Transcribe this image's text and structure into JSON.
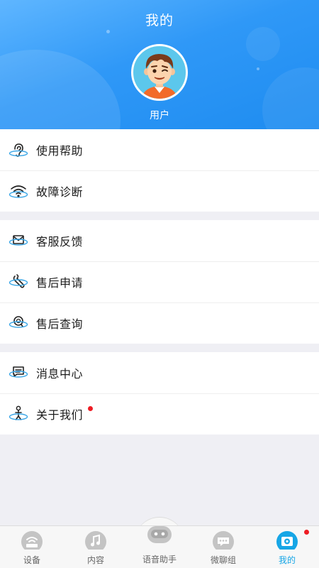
{
  "header": {
    "title": "我的",
    "username": "用户"
  },
  "menu_groups": [
    {
      "items": [
        {
          "label": "使用帮助",
          "icon": "help-ear-icon"
        },
        {
          "label": "故障诊断",
          "icon": "wifi-diagnose-icon"
        }
      ]
    },
    {
      "items": [
        {
          "label": "客服反馈",
          "icon": "mail-feedback-icon"
        },
        {
          "label": "售后申请",
          "icon": "wrench-service-icon"
        },
        {
          "label": "售后查询",
          "icon": "search-query-icon"
        }
      ]
    },
    {
      "items": [
        {
          "label": "消息中心",
          "icon": "message-icon"
        },
        {
          "label": "关于我们",
          "icon": "about-person-icon",
          "badge": true
        }
      ]
    }
  ],
  "tabbar": {
    "tabs": [
      {
        "label": "设备",
        "icon": "router-icon",
        "active": false
      },
      {
        "label": "内容",
        "icon": "music-icon",
        "active": false
      },
      {
        "label": "语音助手",
        "icon": "robot-icon",
        "active": false
      },
      {
        "label": "微聊组",
        "icon": "chat-icon",
        "active": false
      },
      {
        "label": "我的",
        "icon": "profile-gear-icon",
        "active": true,
        "badge": true
      }
    ]
  },
  "colors": {
    "header_gradient_start": "#5fb6ff",
    "header_gradient_end": "#1e8cf0",
    "accent": "#16a6e6",
    "badge": "#ee1c24",
    "icon_blue": "#3aa6e6"
  }
}
